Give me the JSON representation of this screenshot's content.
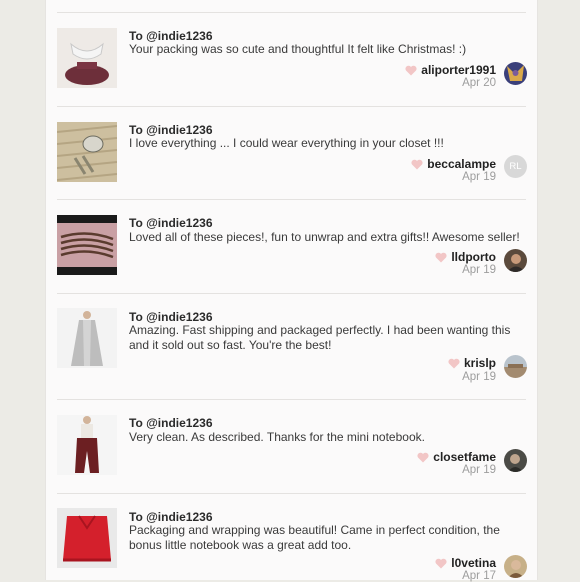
{
  "reviews": [
    {
      "to": "To @indie1236",
      "message": "Your packing was so cute and thoughtful It felt like Christmas! :)",
      "username": "aliporter1991",
      "date": "Apr 20"
    },
    {
      "to": "To @indie1236",
      "message": "I love everything ... I could wear everything in your closet !!!",
      "username": "beccalampe",
      "date": "Apr 19",
      "avatar_initials": "RL"
    },
    {
      "to": "To @indie1236",
      "message": "Loved all of these pieces!, fun to unwrap and extra gifts!! Awesome seller!",
      "username": "lldporto",
      "date": "Apr 19"
    },
    {
      "to": "To @indie1236",
      "message": "Amazing. Fast shipping and packaged perfectly. I had been wanting this and it sold out so fast. You're the best!",
      "username": "krislp",
      "date": "Apr 19"
    },
    {
      "to": "To @indie1236",
      "message": "Very clean. As described. Thanks for the mini notebook.",
      "username": "closetfame",
      "date": "Apr 19"
    },
    {
      "to": "To @indie1236",
      "message": "Packaging and wrapping was beautiful! Came in perfect condition, the bonus little notebook was a great add too.",
      "username": "l0vetina",
      "date": "Apr 17"
    }
  ],
  "icons": {
    "like": "heart-icon"
  },
  "colors": {
    "heart": "#f2c6c6",
    "background": "#fbfafa"
  }
}
